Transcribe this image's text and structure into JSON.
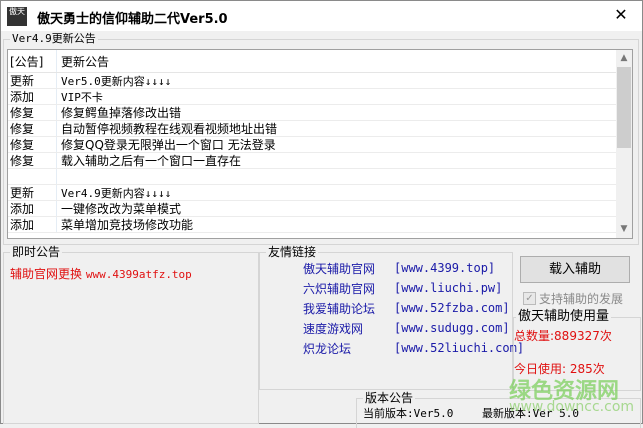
{
  "window": {
    "title": "傲天勇士的信仰辅助二代Ver5.0",
    "icon_text": "傲天",
    "close": "✕"
  },
  "notice": {
    "group_title": "Ver4.9更新公告",
    "headers": [
      "[公告]",
      "更新公告"
    ],
    "rows": [
      [
        "更新",
        "Ver5.0更新内容↓↓↓↓"
      ],
      [
        "添加",
        "VIP不卡"
      ],
      [
        "修复",
        "修复鳄鱼掉落修改出错"
      ],
      [
        "修复",
        "自动暂停视频教程在线观看视频地址出错"
      ],
      [
        "修复",
        "修复QQ登录无限弹出一个窗口 无法登录"
      ],
      [
        "修复",
        "载入辅助之后有一个窗口一直存在"
      ],
      [
        "",
        ""
      ],
      [
        "更新",
        "Ver4.9更新内容↓↓↓↓"
      ],
      [
        "添加",
        "一键修改改为菜单模式"
      ],
      [
        "添加",
        "菜单增加竞技场修改功能"
      ]
    ]
  },
  "instant": {
    "title": "即时公告",
    "text": "辅助官网更换",
    "url": "www.4399atfz.top"
  },
  "links": {
    "title": "友情链接",
    "items": [
      {
        "name": "傲天辅助官网",
        "url": "[www.4399.top]"
      },
      {
        "name": "六炽辅助官网",
        "url": "[www.liuchi.pw]"
      },
      {
        "name": "我爱辅助论坛",
        "url": "[www.52fzba.com]"
      },
      {
        "name": "速度游戏网",
        "url": "[www.sudugg.com]"
      },
      {
        "name": "炽龙论坛",
        "url": "[www.52liuchi.com]"
      }
    ]
  },
  "load_button": "载入辅助",
  "support_checkbox": "支持辅助的发展",
  "usage": {
    "title": "傲天辅助使用量",
    "total": "总数量:889327次",
    "today": "今日使用: 285次"
  },
  "version": {
    "title": "版本公告",
    "current": "当前版本:Ver5.0",
    "latest": "最新版本:Ver 5.0"
  },
  "watermark": {
    "name": "绿色资源网",
    "url": "www.downcc.com"
  }
}
